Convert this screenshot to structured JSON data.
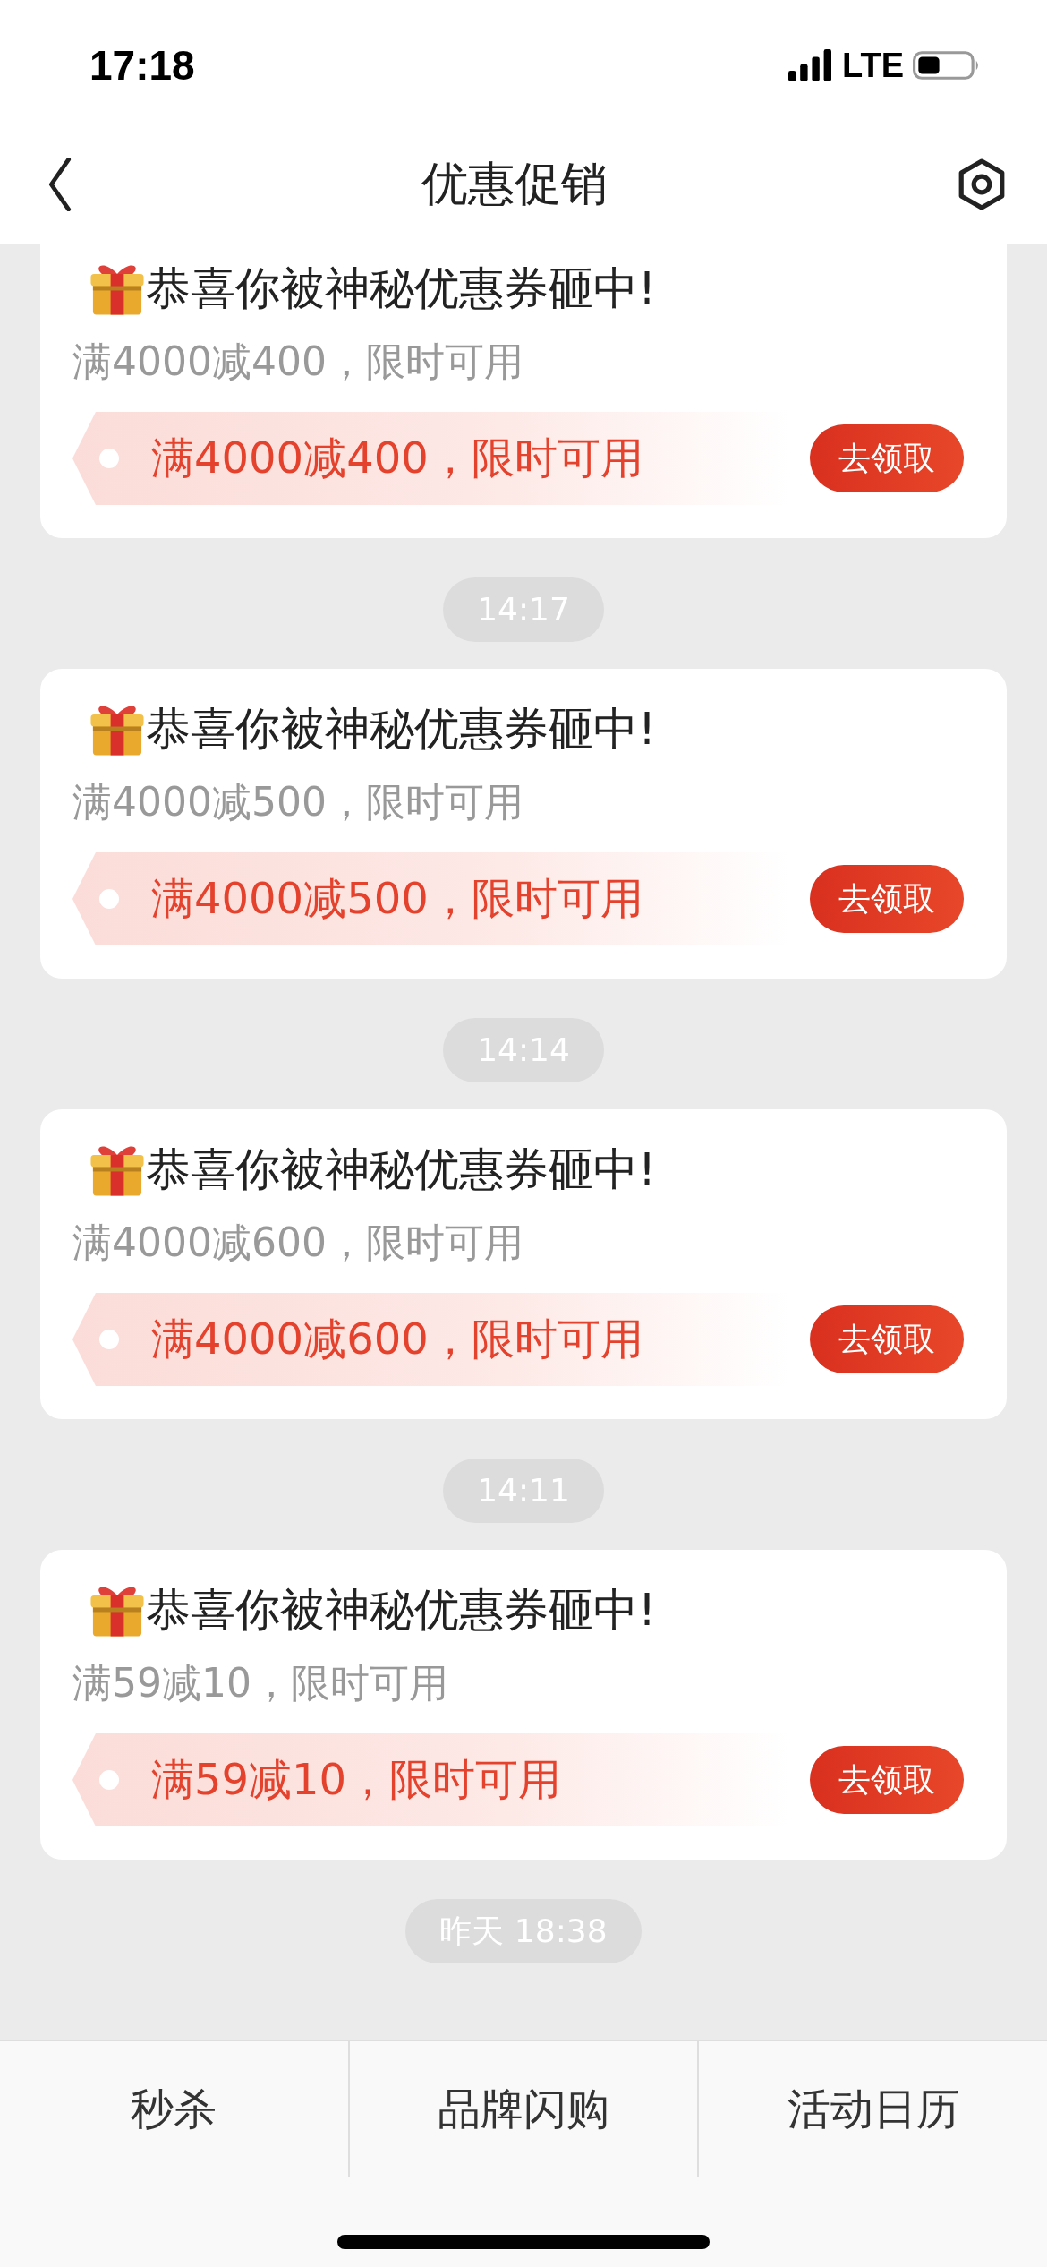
{
  "status_bar": {
    "time": "17:18",
    "network": "LTE"
  },
  "header": {
    "title": "优惠促销"
  },
  "feed": [
    {
      "kind": "card",
      "title": "恭喜你被神秘优惠券砸中!",
      "subtitle": "满4000减400，限时可用",
      "coupon": "满4000减400，限时可用",
      "button": "去领取"
    },
    {
      "kind": "time",
      "label": "14:17"
    },
    {
      "kind": "card",
      "title": "恭喜你被神秘优惠券砸中!",
      "subtitle": "满4000减500，限时可用",
      "coupon": "满4000减500，限时可用",
      "button": "去领取"
    },
    {
      "kind": "time",
      "label": "14:14"
    },
    {
      "kind": "card",
      "title": "恭喜你被神秘优惠券砸中!",
      "subtitle": "满4000减600，限时可用",
      "coupon": "满4000减600，限时可用",
      "button": "去领取"
    },
    {
      "kind": "time",
      "label": "14:11"
    },
    {
      "kind": "card",
      "title": "恭喜你被神秘优惠券砸中!",
      "subtitle": "满59减10，限时可用",
      "coupon": "满59减10，限时可用",
      "button": "去领取"
    },
    {
      "kind": "time",
      "label": "昨天 18:38"
    }
  ],
  "bottom_tabs": [
    {
      "label": "秒杀"
    },
    {
      "label": "品牌闪购"
    },
    {
      "label": "活动日历"
    }
  ]
}
